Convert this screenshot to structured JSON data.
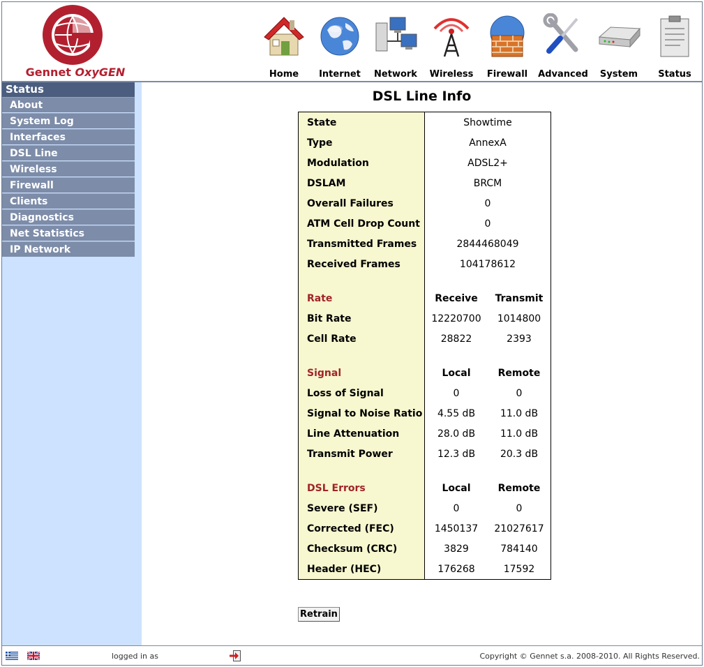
{
  "brand": {
    "name": "Gennet ",
    "name_em": "OxyGEN"
  },
  "colors": {
    "brand": "#b22030",
    "sidebar_bg": "#cce2ff",
    "menu_bg": "#7d8ca8",
    "menu_title": "#4b5e7f",
    "label_cell": "#f7f7d0",
    "section_text": "#a02428"
  },
  "topnav": [
    {
      "label": "Home",
      "icon": "house-icon"
    },
    {
      "label": "Internet",
      "icon": "globe-icon"
    },
    {
      "label": "Network",
      "icon": "network-computers-icon"
    },
    {
      "label": "Wireless",
      "icon": "wireless-tower-icon"
    },
    {
      "label": "Firewall",
      "icon": "firewall-globe-icon"
    },
    {
      "label": "Advanced",
      "icon": "wrench-screwdriver-icon"
    },
    {
      "label": "System",
      "icon": "modem-icon"
    },
    {
      "label": "Status",
      "icon": "clipboard-icon"
    }
  ],
  "sidebar": {
    "title": "Status",
    "items": [
      "About",
      "System Log",
      "Interfaces",
      "DSL Line",
      "Wireless",
      "Firewall",
      "Clients",
      "Diagnostics",
      "Net Statistics",
      "IP Network"
    ]
  },
  "page": {
    "title": "DSL Line Info"
  },
  "info": [
    {
      "label": "State",
      "value": "Showtime"
    },
    {
      "label": "Type",
      "value": "AnnexA"
    },
    {
      "label": "Modulation",
      "value": "ADSL2+"
    },
    {
      "label": "DSLAM",
      "value": "BRCM"
    },
    {
      "label": "Overall Failures",
      "value": "0"
    },
    {
      "label": "ATM Cell Drop Count",
      "value": "0"
    },
    {
      "label": "Transmitted Frames",
      "value": "2844468049"
    },
    {
      "label": "Received Frames",
      "value": "104178612"
    }
  ],
  "rate": {
    "header": {
      "label": "Rate",
      "c1": "Receive",
      "c2": "Transmit"
    },
    "rows": [
      {
        "label": "Bit Rate",
        "c1": "12220700",
        "c2": "1014800"
      },
      {
        "label": "Cell Rate",
        "c1": "28822",
        "c2": "2393"
      }
    ]
  },
  "signal": {
    "header": {
      "label": "Signal",
      "c1": "Local",
      "c2": "Remote"
    },
    "rows": [
      {
        "label": "Loss of Signal",
        "c1": "0",
        "c2": "0"
      },
      {
        "label": "Signal to Noise Ratio",
        "c1": "4.55 dB",
        "c2": "11.0 dB"
      },
      {
        "label": "Line Attenuation",
        "c1": "28.0 dB",
        "c2": "11.0 dB"
      },
      {
        "label": "Transmit Power",
        "c1": "12.3 dB",
        "c2": "20.3 dB"
      }
    ]
  },
  "errors": {
    "header": {
      "label": "DSL Errors",
      "c1": "Local",
      "c2": "Remote"
    },
    "rows": [
      {
        "label": "Severe (SEF)",
        "c1": "0",
        "c2": "0"
      },
      {
        "label": "Corrected (FEC)",
        "c1": "1450137",
        "c2": "21027617"
      },
      {
        "label": "Checksum (CRC)",
        "c1": "3829",
        "c2": "784140"
      },
      {
        "label": "Header (HEC)",
        "c1": "176268",
        "c2": "17592"
      }
    ]
  },
  "actions": {
    "retrain": "Retrain"
  },
  "footer": {
    "logged_in": "logged in as",
    "copyright": "Copyright © Gennet s.a. 2008-2010. All Rights Reserved."
  }
}
